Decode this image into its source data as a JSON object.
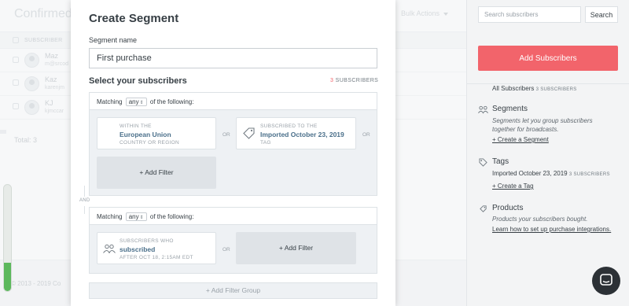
{
  "background": {
    "title": "Confirmed",
    "bulk_actions": "Bulk Actions",
    "column_header": "SUBSCRIBER",
    "rows": [
      {
        "name": "Maz",
        "email": "m@srcod"
      },
      {
        "name": "Kaz",
        "email": "karenjm"
      },
      {
        "name": "KJ",
        "email": "kjmccar"
      }
    ],
    "total": "Total: 3",
    "footer": "© 2013 - 2019 Co",
    "progress_fraction": 0.27
  },
  "sidebar": {
    "search_placeholder": "Search subscribers",
    "search_button": "Search",
    "add_button": "Add Subscribers",
    "all_subscribers": "All Subscribers",
    "all_count": "3 SUBSCRIBERS",
    "segments": {
      "title": "Segments",
      "desc_line1": "Segments let you group subscribers",
      "desc_line2": "together for broadcasts.",
      "link": "+ Create a Segment"
    },
    "tags": {
      "title": "Tags",
      "tag_name": "Imported October 23, 2019",
      "tag_count": "3 SUBSCRIBERS",
      "link": "+ Create a Tag"
    },
    "products": {
      "title": "Products",
      "desc": "Products your subscribers bought.",
      "link": "Learn how to set up purchase integrations."
    }
  },
  "modal": {
    "title": "Create Segment",
    "segment_name_label": "Segment name",
    "segment_name_value": "First purchase",
    "select_heading": "Select your subscribers",
    "subscriber_count": "3",
    "subscriber_count_label": "SUBSCRIBERS",
    "groups": [
      {
        "matching_prefix": "Matching",
        "matching_value": "any",
        "matching_suffix": "of the following:",
        "filters": [
          {
            "top": "WITHIN THE",
            "main": "European Union",
            "bottom": "COUNTRY OR REGION"
          },
          {
            "top": "SUBSCRIBED TO THE",
            "main": "Imported October 23, 2019",
            "bottom": "TAG"
          }
        ],
        "or_labels": [
          "OR",
          "OR"
        ],
        "add_filter": "+ Add Filter"
      },
      {
        "matching_prefix": "Matching",
        "matching_value": "any",
        "matching_suffix": "of the following:",
        "filters": [
          {
            "top": "SUBSCRIBERS WHO",
            "main": "subscribed",
            "bottom": "AFTER OCT 18, 2:15AM EDT"
          }
        ],
        "or_labels": [
          "OR"
        ],
        "add_filter": "+ Add Filter"
      }
    ],
    "and_label": "AND",
    "add_filter_group": "+ Add Filter Group"
  },
  "colors": {
    "accent_red": "#f2646b",
    "progress_green": "#5cb85c",
    "filter_text": "#4a6f8a",
    "chat_button": "#2c3136"
  },
  "icons": [
    "user-avatar-icon",
    "segments-icon",
    "tag-icon",
    "products-icon",
    "location-icon",
    "tag-filter-icon",
    "subscribers-icon",
    "chat-icon"
  ]
}
